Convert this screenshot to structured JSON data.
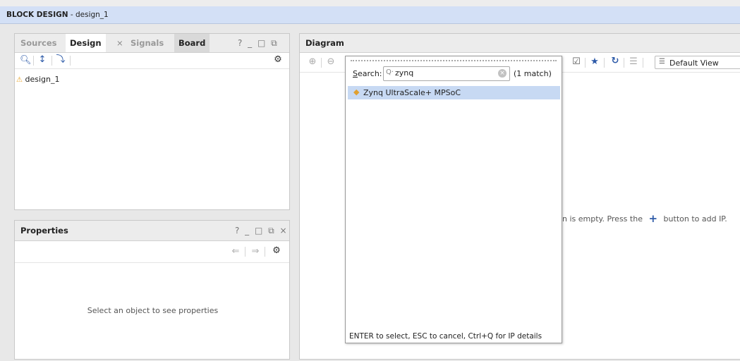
{
  "window": {
    "title_bold": "BLOCK DESIGN",
    "title_rest": " - design_1"
  },
  "sources_panel": {
    "tabs": [
      "Sources",
      "Design",
      "Signals",
      "Board"
    ],
    "close_tab_glyph": "×",
    "window_controls": "? _ □ ⧉",
    "tree": {
      "warning_icon": "warning-icon",
      "root_label": "design_1"
    }
  },
  "properties_panel": {
    "title": "Properties",
    "window_controls": "? _ □ ⧉ ×",
    "empty_message": "Select an object to see properties"
  },
  "diagram_panel": {
    "title": "Diagram",
    "view_select": "Default View",
    "empty_message": "n is empty. Press the",
    "empty_message_tail": "button to add IP."
  },
  "ip_search_popup": {
    "search_label_prefix": "S",
    "search_label_rest": "earch:",
    "query": "zynq",
    "match_count": "(1 match)",
    "results": [
      {
        "label": "Zynq UltraScale+ MPSoC",
        "selected": true
      }
    ],
    "hint": "ENTER to select, ESC to cancel, Ctrl+Q for IP details"
  },
  "colors": {
    "titlebar_bg": "#d3e0f6",
    "selection_bg": "#c7d9f3",
    "accent_blue": "#2d5aa8",
    "add_ip_plus": "#2d5aa8",
    "warning": "#e8a020"
  }
}
